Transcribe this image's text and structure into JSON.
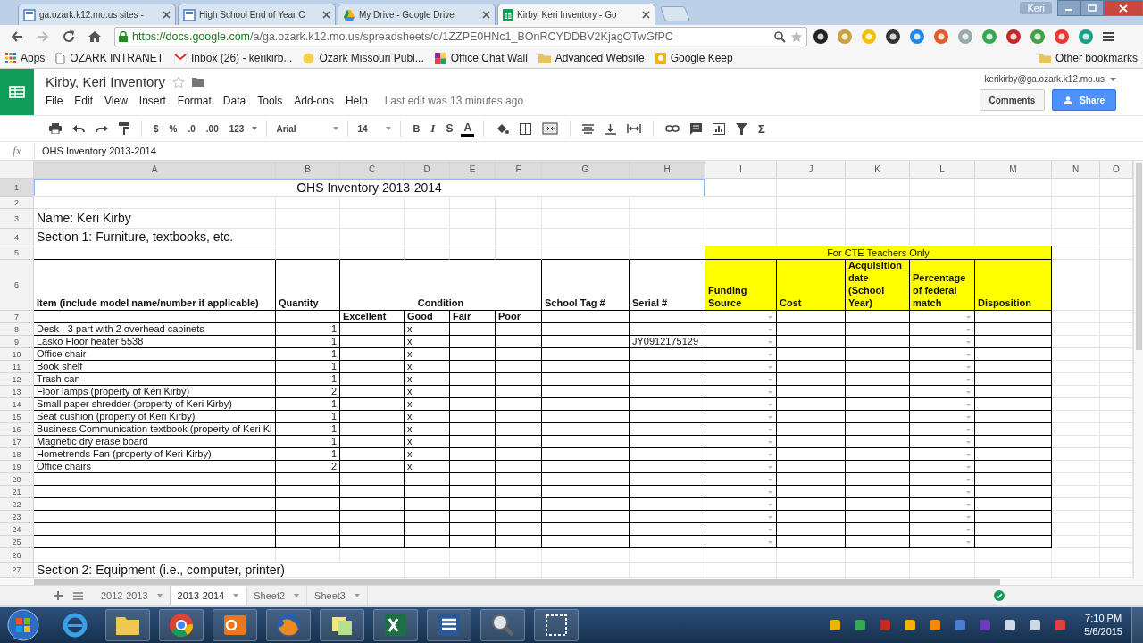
{
  "browser": {
    "tabs": [
      {
        "label": "ga.ozark.k12.mo.us sites -",
        "kind": "site",
        "selected": false
      },
      {
        "label": "High School End of Year C",
        "kind": "site",
        "selected": false
      },
      {
        "label": "My Drive - Google Drive",
        "kind": "drive",
        "selected": false
      },
      {
        "label": "Kirby, Keri Inventory - Go",
        "kind": "sheets",
        "selected": true
      }
    ],
    "user": "Keri",
    "url_host": "https://docs.google.com",
    "url_path": "/a/ga.ozark.k12.mo.us/spreadsheets/d/1ZZPE0HNc1_BOnRCYDDBV2KjagOTwGfPC",
    "bookmarks": [
      {
        "label": "Apps",
        "kind": "apps"
      },
      {
        "label": "OZARK INTRANET",
        "kind": "page"
      },
      {
        "label": "Inbox (26) - kerikirb...",
        "kind": "mail"
      },
      {
        "label": "Ozark Missouri Publ...",
        "kind": "sun"
      },
      {
        "label": "Office Chat Wall",
        "kind": "tile"
      },
      {
        "label": "Advanced Website",
        "kind": "folder"
      },
      {
        "label": "Google Keep",
        "kind": "keep"
      }
    ],
    "other_bookmarks": "Other bookmarks"
  },
  "docs": {
    "title": "Kirby, Keri Inventory",
    "menu": [
      "File",
      "Edit",
      "View",
      "Insert",
      "Format",
      "Data",
      "Tools",
      "Add-ons",
      "Help"
    ],
    "last_edit": "Last edit was 13 minutes ago",
    "account": "kerikirby@ga.ozark.k12.mo.us",
    "comments": "Comments",
    "share": "Share",
    "toolbar": {
      "currency": "$",
      "percent": "%",
      "decrease_decimals": ".0",
      "increase_decimals": ".00",
      "more_formats": "123",
      "font": "Arial",
      "font_size": "14",
      "bold": "B",
      "italic": "I",
      "strike": "S",
      "text_color": "A",
      "functions": "Σ"
    },
    "formula_label": "fx",
    "formula": "OHS Inventory 2013-2014"
  },
  "sheet": {
    "columns": [
      "A",
      "B",
      "C",
      "D",
      "E",
      "F",
      "G",
      "H",
      "I",
      "J",
      "K",
      "L",
      "M",
      "N",
      "O"
    ],
    "row_numbers": [
      "1",
      "2",
      "3",
      "4",
      "5",
      "6",
      "7",
      "8",
      "9",
      "10",
      "11",
      "12",
      "13",
      "14",
      "15",
      "16",
      "17",
      "18",
      "19",
      "20",
      "21",
      "22",
      "23",
      "24",
      "25",
      "26",
      "27"
    ],
    "title": {
      "text": "OHS Inventory 2013-2014",
      "selected": true
    },
    "name_line": "Name: Keri Kirby",
    "section_1": "Section 1:  Furniture, textbooks, etc.",
    "cte_header": "For CTE Teachers Only",
    "headers": [
      "Item (include model name/number if applicable)",
      "Quantity",
      "Condition",
      "School Tag #",
      "Serial #"
    ],
    "cte_columns": [
      "Funding Source",
      "Cost",
      "Acquisition date (School Year)",
      "Percentage of federal match",
      "Disposition"
    ],
    "condition_levels": [
      "Excellent",
      "Good",
      "Fair",
      "Poor"
    ],
    "items": [
      {
        "name": "Desk - 3 part with 2 overhead cabinets",
        "quantity": "1",
        "good": "x"
      },
      {
        "name": "Lasko Floor heater 5538",
        "quantity": "1",
        "good": "x",
        "serial": "JY0912175129"
      },
      {
        "name": "Office chair",
        "quantity": "1",
        "good": "x"
      },
      {
        "name": "Book shelf",
        "quantity": "1",
        "good": "x"
      },
      {
        "name": "Trash can",
        "quantity": "1",
        "good": "x"
      },
      {
        "name": "Floor lamps (property of Keri Kirby)",
        "quantity": "2",
        "good": "x"
      },
      {
        "name": "Small paper shredder (property of Keri Kirby)",
        "quantity": "1",
        "good": "x"
      },
      {
        "name": "Seat cushion (property of Keri Kirby)",
        "quantity": "1",
        "good": "x"
      },
      {
        "name": "Business Communication textbook (property of Keri Ki",
        "quantity": "1",
        "good": "x"
      },
      {
        "name": "Magnetic dry erase board",
        "quantity": "1",
        "good": "x"
      },
      {
        "name": "Hometrends Fan (property of Keri Kirby)",
        "quantity": "1",
        "good": "x"
      },
      {
        "name": "Office chairs",
        "quantity": "2",
        "good": "x"
      }
    ],
    "section_2": "Section 2: Equipment (i.e., computer, printer)"
  },
  "sheet_tabs": [
    {
      "label": "2012-2013",
      "selected": false
    },
    {
      "label": "2013-2014",
      "selected": true
    },
    {
      "label": "Sheet2",
      "selected": false
    },
    {
      "label": "Sheet3",
      "selected": false
    }
  ],
  "taskbar": {
    "time": "7:10 PM",
    "date": "5/6/2015"
  }
}
